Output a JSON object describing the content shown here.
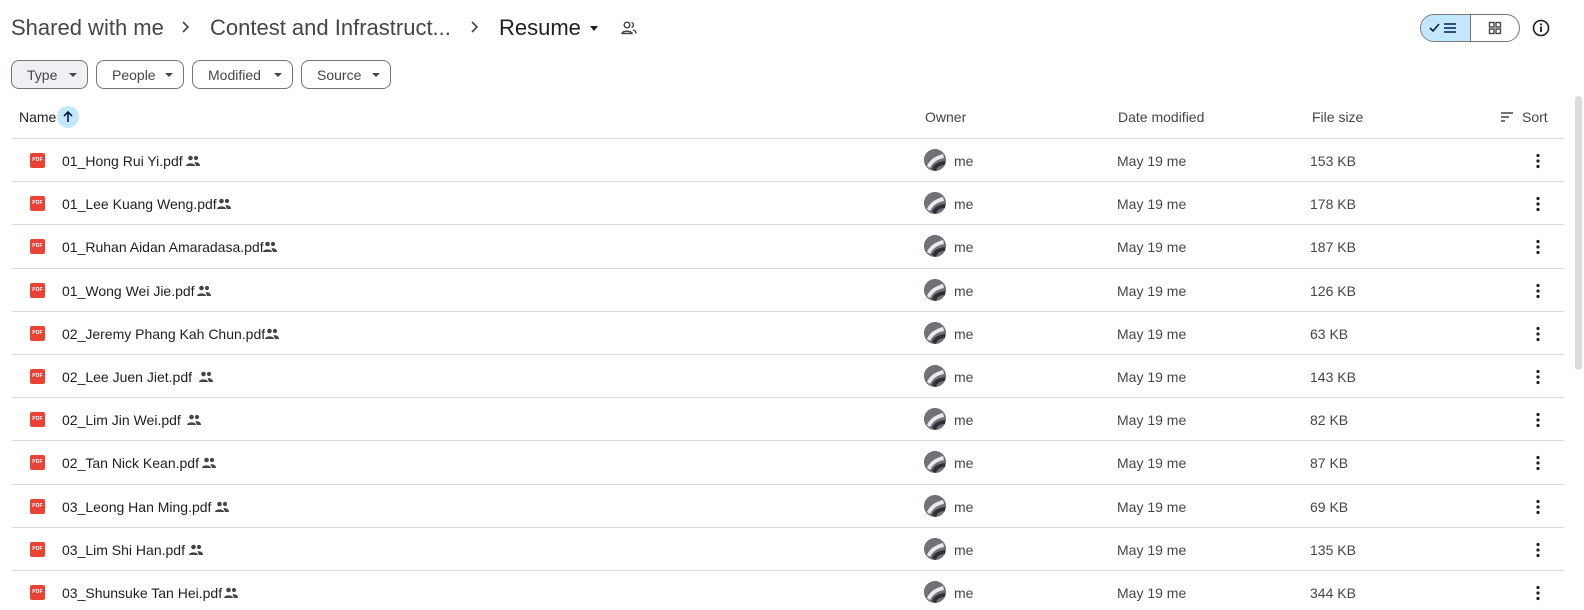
{
  "breadcrumb": {
    "items": [
      "Shared with me",
      "Contest and Infrastruct...",
      "Resume"
    ]
  },
  "filters": [
    "Type",
    "People",
    "Modified",
    "Source"
  ],
  "table": {
    "headers": {
      "name": "Name",
      "owner": "Owner",
      "date": "Date modified",
      "size": "File size",
      "sort": "Sort"
    },
    "rows": [
      {
        "name": "01_Hong Rui Yi.pdf",
        "owner": "me",
        "date": "May 19 me",
        "size": "153 KB"
      },
      {
        "name": "01_Lee Kuang Weng.pdf",
        "owner": "me",
        "date": "May 19 me",
        "size": "178 KB"
      },
      {
        "name": "01_Ruhan Aidan Amaradasa.pdf",
        "owner": "me",
        "date": "May 19 me",
        "size": "187 KB"
      },
      {
        "name": "01_Wong Wei Jie.pdf",
        "owner": "me",
        "date": "May 19 me",
        "size": "126 KB"
      },
      {
        "name": "02_Jeremy Phang Kah Chun.pdf",
        "owner": "me",
        "date": "May 19 me",
        "size": "63 KB"
      },
      {
        "name": "02_Lee Juen Jiet.pdf",
        "owner": "me",
        "date": "May 19 me",
        "size": "143 KB"
      },
      {
        "name": "02_Lim Jin Wei.pdf",
        "owner": "me",
        "date": "May 19 me",
        "size": "82 KB"
      },
      {
        "name": "02_Tan Nick Kean.pdf",
        "owner": "me",
        "date": "May 19 me",
        "size": "87 KB"
      },
      {
        "name": "03_Leong Han Ming.pdf",
        "owner": "me",
        "date": "May 19 me",
        "size": "69 KB"
      },
      {
        "name": "03_Lim Shi Han.pdf",
        "owner": "me",
        "date": "May 19 me",
        "size": "135 KB"
      },
      {
        "name": "03_Shunsuke Tan Hei.pdf",
        "owner": "me",
        "date": "May 19 me",
        "size": "344 KB"
      }
    ]
  },
  "file_icon_label": "PDF",
  "colors": {
    "accent": "#c2e7ff",
    "pdf_red": "#ea4335",
    "divider": "#dadce0"
  },
  "icons": {
    "breadcrumb_separator": "chevron-right-icon",
    "folder_menu": "caret-down-icon",
    "folder_shared": "people-icon",
    "list_view": "list-view-icon",
    "grid_view": "grid-view-icon",
    "details": "info-icon",
    "file": "pdf-icon",
    "file_shared": "shared-icon",
    "row_menu": "more-vert-icon",
    "sort": "sort-lines-icon",
    "sort_direction": "arrow-up-icon"
  }
}
